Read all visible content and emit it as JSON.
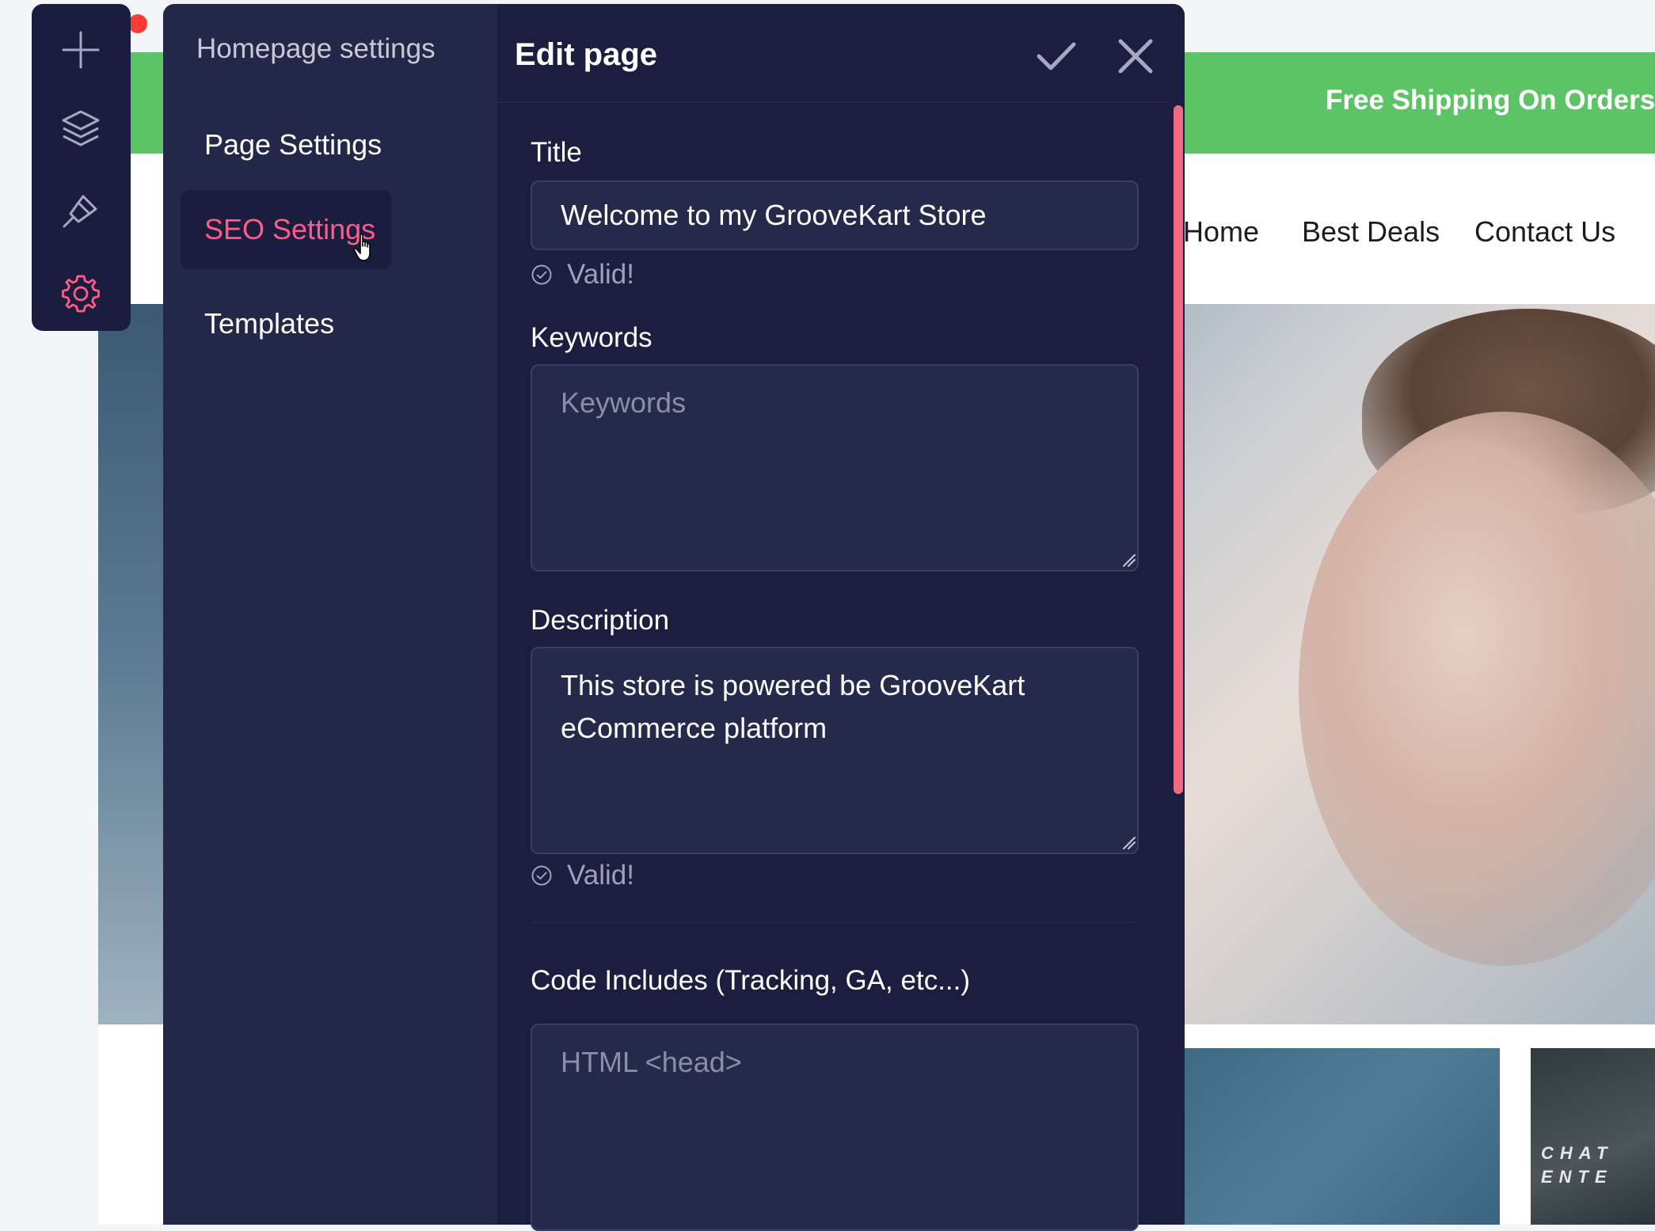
{
  "store": {
    "promo_text": "Free Shipping On Orders $",
    "nav": [
      "Home",
      "Best Deals",
      "Contact Us"
    ],
    "tile_text": [
      "CHAT",
      "ENTE"
    ]
  },
  "rail": {
    "icons": [
      "plus-icon",
      "layers-icon",
      "brush-icon",
      "gear-icon"
    ],
    "active_color": "#ff5a88"
  },
  "sidebar": {
    "title": "Homepage settings",
    "items": [
      {
        "label": "Page Settings",
        "active": false
      },
      {
        "label": "SEO Settings",
        "active": true
      },
      {
        "label": "Templates",
        "active": false
      }
    ]
  },
  "edit": {
    "title": "Edit page",
    "fields": {
      "title": {
        "label": "Title",
        "value": "Welcome to my GrooveKart Store",
        "status": "Valid!"
      },
      "keywords": {
        "label": "Keywords",
        "value": "",
        "placeholder": "Keywords"
      },
      "description": {
        "label": "Description",
        "value": "This store is powered be GrooveKart eCommerce platform",
        "status": "Valid!"
      },
      "code": {
        "label": "Code Includes (Tracking, GA, etc...)",
        "value": "",
        "placeholder": "HTML <head>"
      }
    }
  },
  "colors": {
    "panel_dark": "#1b1e3f",
    "sidebar": "#242848",
    "accent": "#ff5a88",
    "promo": "#5cc466",
    "scrollbar": "#f06a82"
  }
}
